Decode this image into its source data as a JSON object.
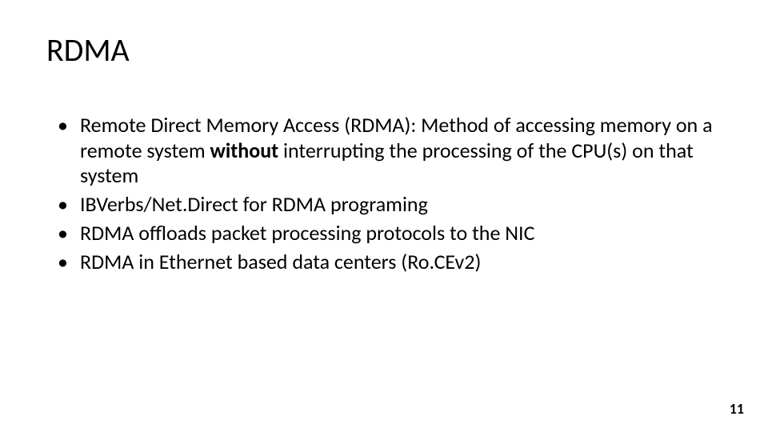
{
  "slide": {
    "title": "RDMA",
    "bullets": [
      {
        "pre": "Remote Direct Memory Access (RDMA): Method of accessing memory on a remote system ",
        "bold": "without",
        "post": " interrupting the processing of the CPU(s) on that system"
      },
      {
        "pre": "IBVerbs/Net.Direct for RDMA programing",
        "bold": "",
        "post": ""
      },
      {
        "pre": "RDMA offloads packet processing protocols to the NIC",
        "bold": "",
        "post": ""
      },
      {
        "pre": "RDMA in Ethernet based data centers (Ro.CEv2)",
        "bold": "",
        "post": ""
      }
    ],
    "page_number": "11"
  }
}
